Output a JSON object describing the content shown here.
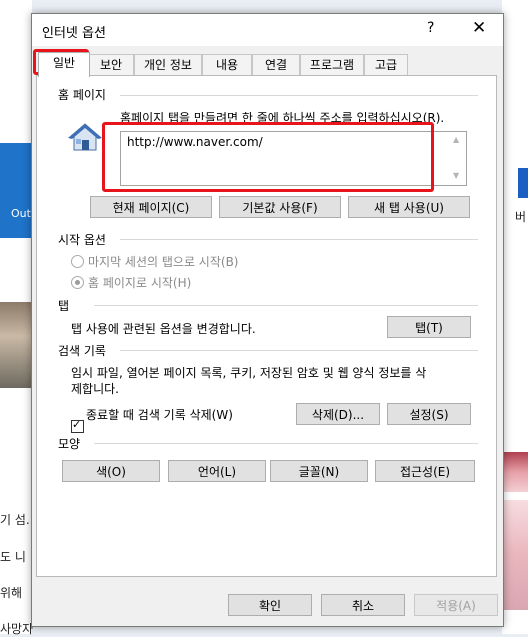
{
  "background": {
    "left_blue_text": "Out",
    "left_lines": [
      "기 섬.",
      "도 니",
      "위해",
      "사망자"
    ],
    "right_text": "버"
  },
  "dialog": {
    "title": "인터넷 옵션",
    "help": "?",
    "close": "✕",
    "tabs": [
      "일반",
      "보안",
      "개인 정보",
      "내용",
      "연결",
      "프로그램",
      "고급"
    ],
    "active_tab": "일반"
  },
  "homepage": {
    "label": "홈 페이지",
    "hint": "홈페이지 탭을 만들려면 한 줄에 하나씩 주소를 입력하십시오(R).",
    "url": "http://www.naver.com/",
    "buttons": [
      "현재 페이지(C)",
      "기본값 사용(F)",
      "새 탭 사용(U)"
    ]
  },
  "startup": {
    "label": "시작 옵션",
    "options": [
      "마지막 세션의 탭으로 시작(B)",
      "홈 페이지로 시작(H)"
    ],
    "selected": "홈 페이지로 시작(H)"
  },
  "tabs_section": {
    "label": "탭",
    "text": "탭 사용에 관련된 옵션을 변경합니다.",
    "button": "탭(T)"
  },
  "history": {
    "label": "검색 기록",
    "text_line1": "임시 파일, 열어본 페이지 목록, 쿠키, 저장된 암호 및 웹 양식 정보를 삭",
    "text_line2": "제합니다.",
    "checkbox_label": "종료할 때 검색 기록 삭제(W)",
    "checkbox_checked": true,
    "delete_button": "삭제(D)...",
    "settings_button": "설정(S)"
  },
  "appearance": {
    "label": "모양",
    "buttons": [
      "색(O)",
      "언어(L)",
      "글꼴(N)",
      "접근성(E)"
    ]
  },
  "footer": {
    "ok": "확인",
    "cancel": "취소",
    "apply": "적용(A)"
  },
  "highlight_color": "#e8141b"
}
